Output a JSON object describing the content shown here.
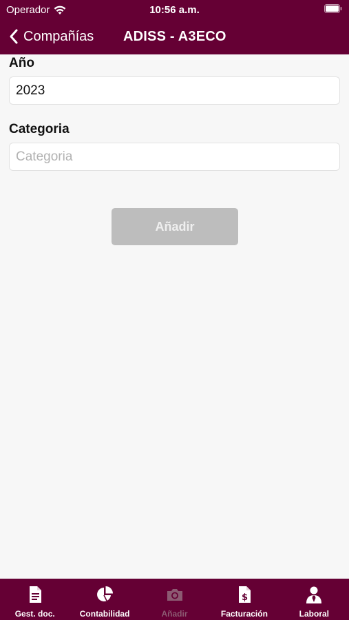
{
  "status_bar": {
    "carrier": "Operador",
    "time": "10:56 a.m."
  },
  "navbar": {
    "back_label": "Compañías",
    "title": "ADISS - A3ECO"
  },
  "form": {
    "year_label": "Año",
    "year_value": "2023",
    "category_label": "Categoria",
    "category_placeholder": "Categoria",
    "add_button_label": "Añadir"
  },
  "tabbar": {
    "items": [
      {
        "label": "Gest. doc.",
        "icon": "document-icon"
      },
      {
        "label": "Contabilidad",
        "icon": "pie-chart-icon"
      },
      {
        "label": "Añadir",
        "icon": "camera-icon"
      },
      {
        "label": "Facturación",
        "icon": "invoice-icon"
      },
      {
        "label": "Laboral",
        "icon": "person-icon"
      }
    ]
  },
  "colors": {
    "brand": "#650034",
    "button_disabled": "#bdbdbd",
    "background": "#f7f7f7"
  }
}
